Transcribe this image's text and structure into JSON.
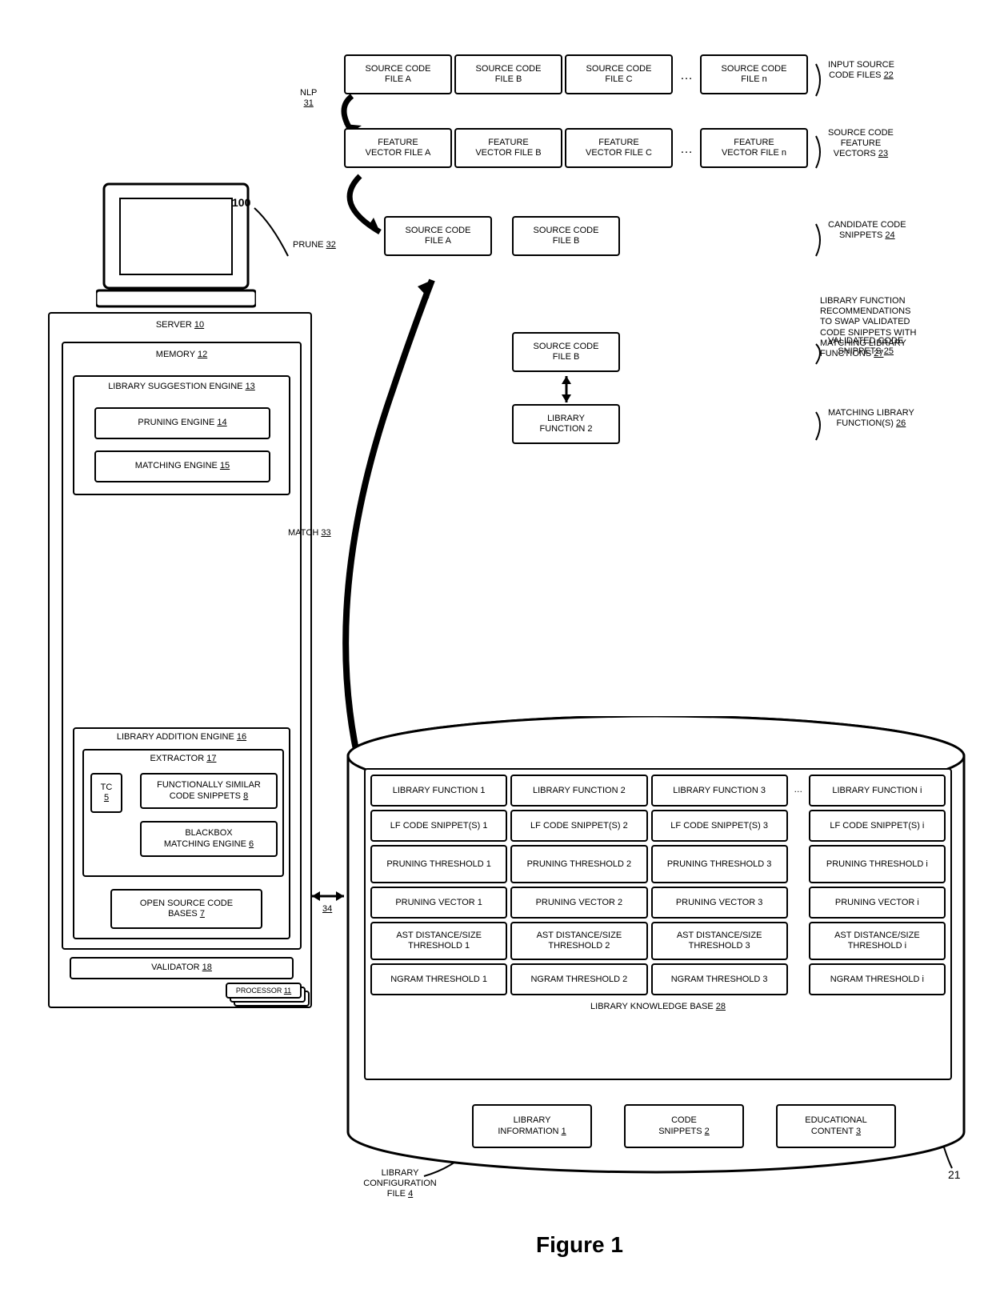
{
  "ref100": "100",
  "figure": "Figure 1",
  "server": {
    "title": "SERVER",
    "num": "10"
  },
  "memory": {
    "title": "MEMORY",
    "num": "12"
  },
  "lsEngine": {
    "title": "LIBRARY SUGGESTION ENGINE",
    "num": "13"
  },
  "pruningEngine": {
    "title": "PRUNING ENGINE",
    "num": "14"
  },
  "matchingEngine": {
    "title": "MATCHING ENGINE",
    "num": "15"
  },
  "laEngine": {
    "title": "LIBRARY ADDITION ENGINE",
    "num": "16"
  },
  "extractor": {
    "title": "EXTRACTOR",
    "num": "17"
  },
  "tc": {
    "title": "TC",
    "num": "5"
  },
  "funcSimilar": {
    "line1": "FUNCTIONALLY SIMILAR",
    "line2": "CODE SNIPPETS",
    "num": "8"
  },
  "blackbox": {
    "line1": "BLACKBOX",
    "line2": "MATCHING ENGINE",
    "num": "6"
  },
  "openSource": {
    "line1": "OPEN SOURCE CODE",
    "line2": "BASES",
    "num": "7"
  },
  "validator": {
    "title": "VALIDATOR",
    "num": "18"
  },
  "processor": {
    "title": "PROCESSOR",
    "num": "11"
  },
  "nlp": {
    "title": "NLP",
    "num": "31"
  },
  "prune": {
    "title": "PRUNE",
    "num": "32"
  },
  "match": {
    "title": "MATCH",
    "num": "33"
  },
  "arrow34": "34",
  "srcA": {
    "line1": "SOURCE CODE",
    "line2": "FILE A"
  },
  "srcB": {
    "line1": "SOURCE CODE",
    "line2": "FILE B"
  },
  "srcC": {
    "line1": "SOURCE CODE",
    "line2": "FILE C"
  },
  "srcN": {
    "line1": "SOURCE CODE",
    "line2": "FILE n"
  },
  "dots": "…",
  "inputSrc": {
    "line1": "INPUT SOURCE",
    "line2": "CODE FILES",
    "num": "22"
  },
  "fvA": {
    "line1": "FEATURE",
    "line2": "VECTOR FILE A"
  },
  "fvB": {
    "line1": "FEATURE",
    "line2": "VECTOR FILE B"
  },
  "fvC": {
    "line1": "FEATURE",
    "line2": "VECTOR FILE C"
  },
  "fvN": {
    "line1": "FEATURE",
    "line2": "VECTOR FILE n"
  },
  "srcFeat": {
    "line1": "SOURCE CODE",
    "line2": "FEATURE",
    "line3": "VECTORS",
    "num": "23"
  },
  "candSrcA": {
    "line1": "SOURCE CODE",
    "line2": "FILE A"
  },
  "candSrcB": {
    "line1": "SOURCE CODE",
    "line2": "FILE B"
  },
  "candidate": {
    "line1": "CANDIDATE CODE",
    "line2": "SNIPPETS",
    "num": "24"
  },
  "valSrcB": {
    "line1": "SOURCE CODE",
    "line2": "FILE B"
  },
  "validated": {
    "line1": "VALIDATED CODE",
    "line2": "SNIPPETS",
    "num": "25"
  },
  "matchLib2": {
    "line1": "LIBRARY",
    "line2": "FUNCTION 2"
  },
  "matchingLib": {
    "line1": "MATCHING LIBRARY",
    "line2": "FUNCTION(S)",
    "num": "26"
  },
  "recText": {
    "l1": "LIBRARY FUNCTION",
    "l2": "RECOMMENDATIONS",
    "l3": "TO SWAP VALIDATED",
    "l4": "CODE SNIPPETS WITH",
    "l5": "MATCHING LIBRARY",
    "l6": "FUNCTIONS",
    "num": "27"
  },
  "kbNum": "21",
  "kb": {
    "label": "LIBRARY KNOWLEDGE BASE",
    "num": "28",
    "header": {
      "c1": "LIBRARY FUNCTION 1",
      "c2": "LIBRARY FUNCTION 2",
      "c3": "LIBRARY FUNCTION 3",
      "ci": "LIBRARY FUNCTION i"
    },
    "r2": {
      "c1": "LF CODE SNIPPET(S) 1",
      "c2": "LF CODE SNIPPET(S) 2",
      "c3": "LF CODE SNIPPET(S) 3",
      "ci": "LF CODE SNIPPET(S) i"
    },
    "r3": {
      "c1": "PRUNING THRESHOLD 1",
      "c2": "PRUNING THRESHOLD 2",
      "c3": "PRUNING THRESHOLD 3",
      "ci": "PRUNING THRESHOLD i"
    },
    "r4": {
      "c1": "PRUNING VECTOR 1",
      "c2": "PRUNING VECTOR 2",
      "c3": "PRUNING VECTOR 3",
      "ci": "PRUNING VECTOR i"
    },
    "r5": {
      "c1": "AST DISTANCE/SIZE THRESHOLD 1",
      "c2": "AST DISTANCE/SIZE THRESHOLD 2",
      "c3": "AST DISTANCE/SIZE THRESHOLD 3",
      "ci": "AST DISTANCE/SIZE THRESHOLD i"
    },
    "r6": {
      "c1": "NGRAM THRESHOLD 1",
      "c2": "NGRAM THRESHOLD 2",
      "c3": "NGRAM THRESHOLD 3",
      "ci": "NGRAM THRESHOLD i"
    }
  },
  "libInfo": {
    "line1": "LIBRARY",
    "line2": "INFORMATION",
    "num": "1"
  },
  "codeSnip": {
    "line1": "CODE",
    "line2": "SNIPPETS",
    "num": "2"
  },
  "eduContent": {
    "line1": "EDUCATIONAL",
    "line2": "CONTENT",
    "num": "3"
  },
  "libConfig": {
    "line1": "LIBRARY",
    "line2": "CONFIGURATION",
    "line3": "FILE",
    "num": "4"
  }
}
